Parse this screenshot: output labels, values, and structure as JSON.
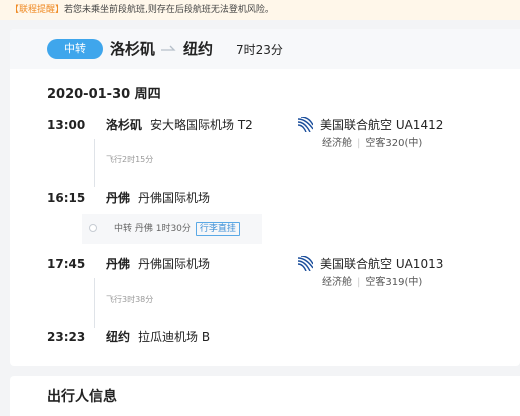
{
  "notice": {
    "tag": "【联程提醒】",
    "text": "若您未乘坐前段航班,则存在后段航班无法登机风险。"
  },
  "header": {
    "badge": "中转",
    "from_city": "洛杉矶",
    "to_city": "纽约",
    "duration": "7时23分"
  },
  "date": "2020-01-30  周四",
  "segments": [
    {
      "depart_time": "13:00",
      "depart_city": "洛杉矶",
      "depart_airport": "安大略国际机场 T2",
      "flight_time": "飞行2时15分",
      "arrive_time": "16:15",
      "arrive_city": "丹佛",
      "arrive_airport": "丹佛国际机场",
      "airline": "美国联合航空 UA1412",
      "cabin": "经济舱",
      "aircraft": "空客320(中)"
    },
    {
      "depart_time": "17:45",
      "depart_city": "丹佛",
      "depart_airport": "丹佛国际机场",
      "flight_time": "飞行3时38分",
      "arrive_time": "23:23",
      "arrive_city": "纽约",
      "arrive_airport": "拉瓜迪机场 B",
      "airline": "美国联合航空 UA1013",
      "cabin": "经济舱",
      "aircraft": "空客319(中)"
    }
  ],
  "transfer": {
    "text": "中转 丹佛 1时30分",
    "luggage": "行李直挂"
  },
  "passengers": {
    "title": "出行人信息"
  },
  "colors": {
    "accent": "#3fa6ec",
    "notice_tag": "#ef8a24",
    "airline_logo": "#1c4f9c"
  },
  "icons": {
    "airline_logo": "united-airlines-logo-icon",
    "route_arrow": "arrow-right-icon",
    "transfer_dot": "circle-icon"
  }
}
